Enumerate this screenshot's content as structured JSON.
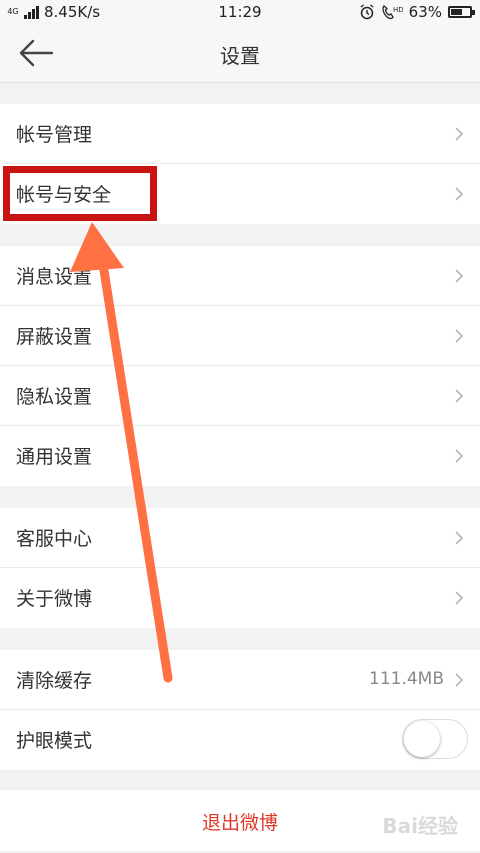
{
  "status_bar": {
    "network": "4G",
    "speed": "8.45K/s",
    "time": "11:29",
    "battery": "63%",
    "battery_level": 0.63,
    "icons": [
      "signal-icon",
      "alarm-icon",
      "hd-call-icon",
      "battery-icon"
    ]
  },
  "header": {
    "title": "设置",
    "back_icon": "arrow-left-icon"
  },
  "groups": [
    {
      "items": [
        {
          "label": "帐号管理"
        },
        {
          "label": "帐号与安全"
        }
      ]
    },
    {
      "items": [
        {
          "label": "消息设置"
        },
        {
          "label": "屏蔽设置"
        },
        {
          "label": "隐私设置"
        },
        {
          "label": "通用设置"
        }
      ]
    },
    {
      "items": [
        {
          "label": "客服中心"
        },
        {
          "label": "关于微博"
        }
      ]
    },
    {
      "items": [
        {
          "label": "清除缓存",
          "value": "111.4MB"
        },
        {
          "label": "护眼模式",
          "toggle": false
        }
      ]
    }
  ],
  "logout": {
    "label": "退出微博"
  },
  "watermark": "Bai经验",
  "colors": {
    "logout_text": "#e0392b",
    "highlight_border": "#c91414",
    "arrow": "#ff7043",
    "background": "#f2f2f2"
  }
}
